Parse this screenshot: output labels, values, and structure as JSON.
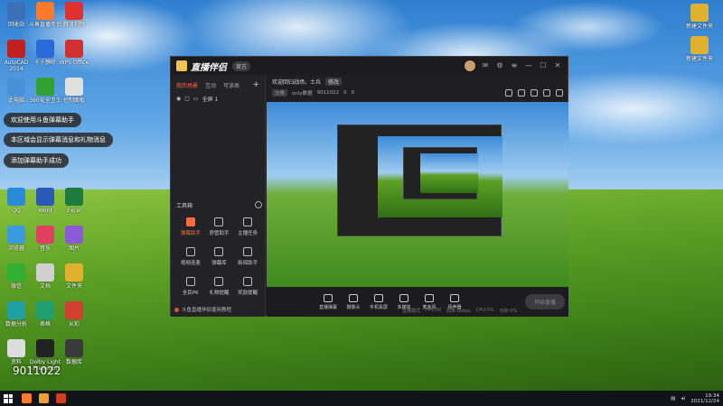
{
  "desktop": {
    "icons_left": [
      {
        "label": "回收站",
        "color": "#3b6fb6"
      },
      {
        "label": "斗鱼直播伴侣",
        "color": "#ff7a2a"
      },
      {
        "label": "腾讯视频",
        "color": "#e03030"
      },
      {
        "label": "AutoCAD 2014",
        "color": "#c02020"
      },
      {
        "label": "千千静听",
        "color": "#2a6ad8"
      },
      {
        "label": "WPS Office",
        "color": "#d03030"
      },
      {
        "label": "此电脑",
        "color": "#4a90d8"
      },
      {
        "label": "360安全卫士",
        "color": "#30a030"
      },
      {
        "label": "控制面板",
        "color": "#e0e0e0"
      },
      {
        "label": "QQ",
        "color": "#2a8ad8"
      },
      {
        "label": "Word",
        "color": "#2a5ab8"
      },
      {
        "label": "Excel",
        "color": "#1f7a40"
      },
      {
        "label": "浏览器",
        "color": "#3a9ae0"
      },
      {
        "label": "音乐",
        "color": "#e04060"
      },
      {
        "label": "图片",
        "color": "#8a5ad8"
      },
      {
        "label": "微信",
        "color": "#30b030"
      },
      {
        "label": "文档",
        "color": "#d0d0d0"
      },
      {
        "label": "文件夹",
        "color": "#e0b030"
      },
      {
        "label": "数据分析",
        "color": "#20a0a0"
      },
      {
        "label": "表格",
        "color": "#20a070"
      },
      {
        "label": "从彩",
        "color": "#d04030"
      },
      {
        "label": "资料",
        "color": "#dddddd"
      },
      {
        "label": "Dolby Light Premium",
        "color": "#222222"
      },
      {
        "label": "数据库",
        "color": "#3a3a3a"
      }
    ],
    "icons_right": [
      {
        "label": "新建文件夹",
        "color": "#e0b030"
      },
      {
        "label": "新建文件夹",
        "color": "#e0b030"
      }
    ],
    "toasts": [
      "欢迎使用斗鱼弹幕助手",
      "本区域会显示弹幕消息和礼物消息",
      "添加弹幕助手成功"
    ]
  },
  "window": {
    "app_name": "直播伴侣",
    "version": "官方",
    "tabs": [
      "我的场景",
      "互动",
      "可读表"
    ],
    "active_tab": "我的场景",
    "scene_label": "全屏 1",
    "tools_title": "工具箱",
    "tools": [
      {
        "label": "弹幕助手",
        "active": true
      },
      {
        "label": "房管助手",
        "active": false
      },
      {
        "label": "主播任务",
        "active": false
      },
      {
        "label": "视频连麦",
        "active": false
      },
      {
        "label": "弹幕库",
        "active": false
      },
      {
        "label": "新闻助手",
        "active": false
      },
      {
        "label": "全民PK",
        "active": false
      },
      {
        "label": "礼物提醒",
        "active": false
      },
      {
        "label": "奖励提醒",
        "active": false
      }
    ],
    "left_footer": "斗鱼直播伴侣使用教程",
    "room_title": "欢迎回归战场，士兵",
    "edit_label": "修改",
    "room_meta": {
      "category": "分类",
      "name": "only数据",
      "room_id": "9011022",
      "viewers": "0",
      "likes": "0"
    },
    "controls": [
      "直播弹幕",
      "摄像头",
      "手机投屏",
      "多媒体",
      "麦克风",
      "扬声器"
    ],
    "start_label": "开始直播",
    "status": [
      "直播模式",
      "FPS:30",
      "码率:0kbps",
      "CPU:0%",
      "内存:0%"
    ]
  },
  "watermark": "9011022",
  "taskbar": {
    "time": "19:34",
    "date": "2021/12/24",
    "apps": [
      {
        "color": "#ff7a2a"
      },
      {
        "color": "#f0a030"
      },
      {
        "color": "#d04020"
      }
    ]
  }
}
